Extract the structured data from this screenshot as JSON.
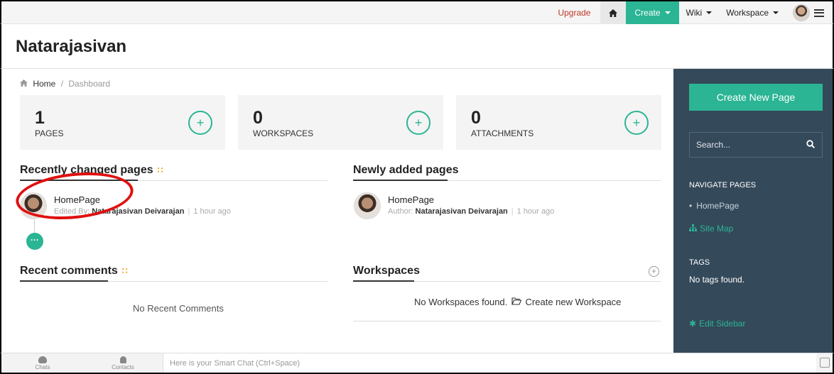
{
  "topnav": {
    "upgrade": "Upgrade",
    "create": "Create",
    "wiki": "Wiki",
    "workspace": "Workspace"
  },
  "header": {
    "title": "Natarajasivan"
  },
  "breadcrumb": {
    "home": "Home",
    "separator": "/",
    "current": "Dashboard"
  },
  "stats": [
    {
      "value": "1",
      "label": "PAGES"
    },
    {
      "value": "0",
      "label": "WORKSPACES"
    },
    {
      "value": "0",
      "label": "ATTACHMENTS"
    }
  ],
  "recently_changed": {
    "title": "Recently changed pages",
    "items": [
      {
        "title": "HomePage",
        "meta_prefix": "Edited By:",
        "author": "Natarajasivan Deivarajan",
        "time": "1 hour ago"
      }
    ],
    "more": "···"
  },
  "newly_added": {
    "title": "Newly added pages",
    "items": [
      {
        "title": "HomePage",
        "meta_prefix": "Author:",
        "author": "Natarajasivan Deivarajan",
        "time": "1 hour ago"
      }
    ]
  },
  "recent_comments": {
    "title": "Recent comments",
    "empty": "No Recent Comments"
  },
  "workspaces": {
    "title": "Workspaces",
    "empty": "No Workspaces found.",
    "create_link": "Create new Workspace"
  },
  "sidebar": {
    "create_button": "Create New Page",
    "search_placeholder": "Search...",
    "navigate_heading": "NAVIGATE PAGES",
    "pages": [
      "HomePage"
    ],
    "site_map": "Site Map",
    "tags_heading": "TAGS",
    "tags_empty": "No tags found.",
    "edit_sidebar": "Edit Sidebar"
  },
  "chatbar": {
    "chats": "Chats",
    "contacts": "Contacts",
    "placeholder": "Here is your Smart Chat (Ctrl+Space)"
  },
  "colors": {
    "accent": "#2bb594",
    "sidebar_bg": "#34495a",
    "upgrade": "#c0392b",
    "annotation": "#e01010"
  }
}
